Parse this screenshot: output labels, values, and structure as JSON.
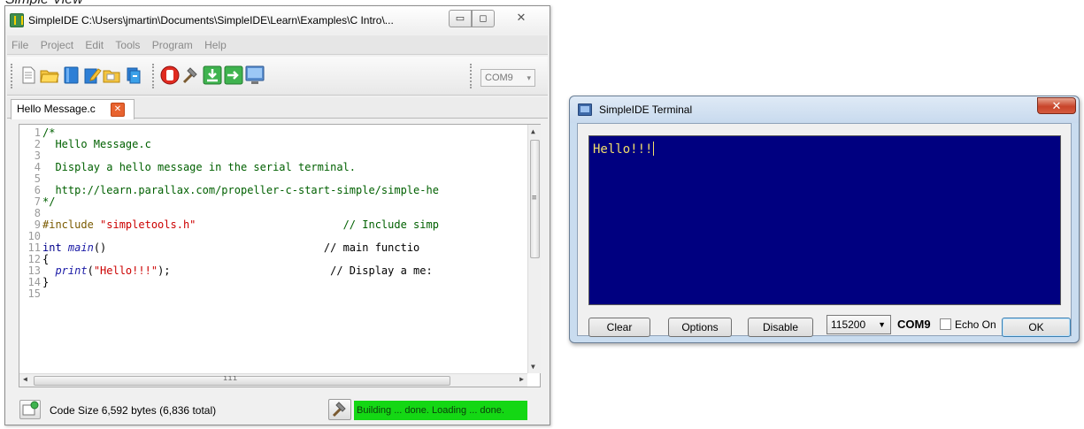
{
  "caption": "Simple View",
  "ide": {
    "title": "SimpleIDE C:\\Users\\jmartin\\Documents\\SimpleIDE\\Learn\\Examples\\C Intro\\...",
    "window_controls": {
      "minimize": "▭",
      "maximize": "◻",
      "close": "✕"
    },
    "menu": [
      "File",
      "Project",
      "Edit",
      "Tools",
      "Program",
      "Help"
    ],
    "toolbar": {
      "icons": [
        "new-file-icon",
        "open-folder-icon",
        "save-icon",
        "edit-icon",
        "project-folder-icon",
        "book-icon",
        "stop-icon",
        "build-hammer-icon",
        "load-ram-icon",
        "load-eeprom-icon",
        "terminal-icon"
      ],
      "port": "COM9",
      "port_arrow": "▾"
    },
    "tab": {
      "label": "Hello Message.c",
      "close": "✕"
    },
    "scroll_glyphs": {
      "up": "▲",
      "down": "▼",
      "left": "◀",
      "right": "▶",
      "vgrip": "≡",
      "hgrip": "ııı"
    },
    "code_lines": [
      {
        "n": "1",
        "text": "/*"
      },
      {
        "n": "2",
        "text": "  Hello Message.c"
      },
      {
        "n": "3",
        "text": ""
      },
      {
        "n": "4",
        "text": "  Display a hello message in the serial terminal."
      },
      {
        "n": "5",
        "text": ""
      },
      {
        "n": "6",
        "text": "  http://learn.parallax.com/propeller-c-start-simple/simple-he"
      },
      {
        "n": "7",
        "text": "*/"
      },
      {
        "n": "8",
        "text": ""
      },
      {
        "n": "9",
        "a": "#include ",
        "b": "\"simpletools.h\"",
        "c": "                       // Include simp"
      },
      {
        "n": "10",
        "text": ""
      },
      {
        "n": "11",
        "a": "int ",
        "b": "main",
        "c": "()                                  // main functio"
      },
      {
        "n": "12",
        "text": "{"
      },
      {
        "n": "13",
        "a": "  print",
        "b": "(",
        "c": "\"Hello!!!\"",
        "d": ");                         // Display a me:"
      },
      {
        "n": "14",
        "text": "}"
      },
      {
        "n": "15",
        "text": ""
      }
    ],
    "status": {
      "code_size": "Code Size 6,592 bytes (6,836 total)",
      "build": "Building ... done. Loading ... done."
    }
  },
  "terminal": {
    "title": "SimpleIDE Terminal",
    "close": "✕",
    "output": "Hello!!!",
    "buttons": {
      "clear": "Clear",
      "options": "Options",
      "disable": "Disable",
      "ok": "OK"
    },
    "baud": "115200",
    "baud_arrow": "▼",
    "port": "COM9",
    "echo_label": "Echo On"
  },
  "colors": {
    "terminal_bg": "#000080",
    "terminal_text": "#f2df6a",
    "build_status_bg": "#14d714"
  }
}
